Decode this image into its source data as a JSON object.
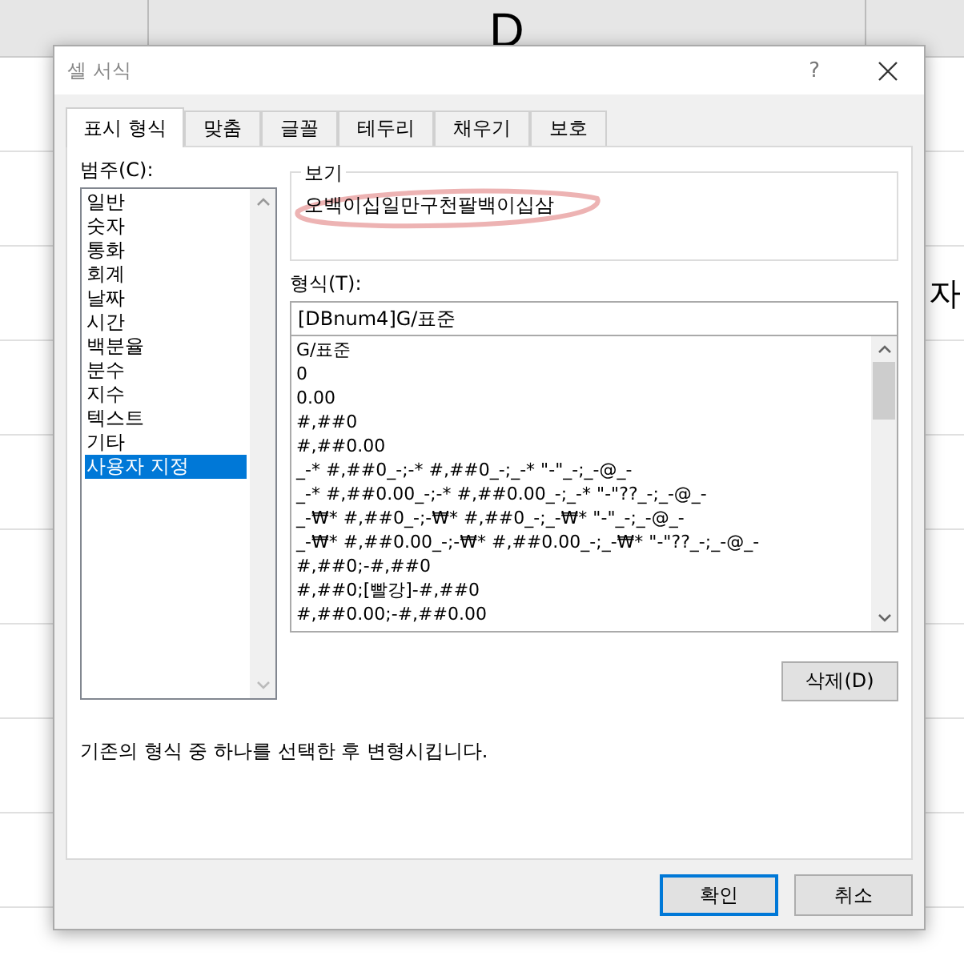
{
  "spreadsheet": {
    "column_header": "D",
    "cell_text": "자"
  },
  "dialog": {
    "title": "셀 서식",
    "help": "?"
  },
  "tabs": [
    {
      "label": "표시 형식",
      "selected": true
    },
    {
      "label": "맞춤",
      "selected": false
    },
    {
      "label": "글꼴",
      "selected": false
    },
    {
      "label": "테두리",
      "selected": false
    },
    {
      "label": "채우기",
      "selected": false
    },
    {
      "label": "보호",
      "selected": false
    }
  ],
  "category": {
    "label": "범주(C):",
    "items": [
      {
        "label": "일반",
        "selected": false
      },
      {
        "label": "숫자",
        "selected": false
      },
      {
        "label": "통화",
        "selected": false
      },
      {
        "label": "회계",
        "selected": false
      },
      {
        "label": "날짜",
        "selected": false
      },
      {
        "label": "시간",
        "selected": false
      },
      {
        "label": "백분율",
        "selected": false
      },
      {
        "label": "분수",
        "selected": false
      },
      {
        "label": "지수",
        "selected": false
      },
      {
        "label": "텍스트",
        "selected": false
      },
      {
        "label": "기타",
        "selected": false
      },
      {
        "label": "사용자 지정",
        "selected": true
      }
    ]
  },
  "preview": {
    "label": "보기",
    "value": "오백이십일만구천팔백이십삼"
  },
  "format": {
    "label": "형식(T):",
    "value": "[DBnum4]G/표준",
    "items": [
      {
        "label": "G/표준",
        "selected": false
      },
      {
        "label": "0",
        "selected": false
      },
      {
        "label": "0.00",
        "selected": false
      },
      {
        "label": "#,##0",
        "selected": false
      },
      {
        "label": "#,##0.00",
        "selected": false
      },
      {
        "label": "_-* #,##0_-;-* #,##0_-;_-* \"-\"_-;_-@_-",
        "selected": false
      },
      {
        "label": "_-* #,##0.00_-;-* #,##0.00_-;_-* \"-\"??_-;_-@_-",
        "selected": false
      },
      {
        "label": "_-₩* #,##0_-;-₩* #,##0_-;_-₩* \"-\"_-;_-@_-",
        "selected": false
      },
      {
        "label": "_-₩* #,##0.00_-;-₩* #,##0.00_-;_-₩* \"-\"??_-;_-@_-",
        "selected": false
      },
      {
        "label": "#,##0;-#,##0",
        "selected": false
      },
      {
        "label": "#,##0;[빨강]-#,##0",
        "selected": false
      },
      {
        "label": "#,##0.00;-#,##0.00",
        "selected": false
      }
    ]
  },
  "delete_button": "삭제(D)",
  "description": "기존의 형식 중 하나를 선택한 후 변형시킵니다.",
  "buttons": [
    {
      "label": "확인",
      "kind": "default"
    },
    {
      "label": "취소",
      "kind": "normal"
    }
  ]
}
